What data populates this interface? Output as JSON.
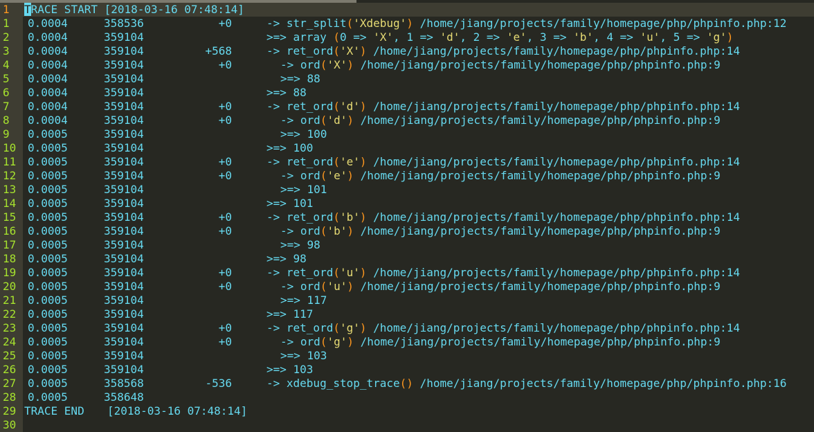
{
  "trace_header": {
    "label": "TRACE START",
    "timestamp": "[2018-03-16 07:48:14]"
  },
  "trace_footer": {
    "label": "TRACE END",
    "timestamp": "[2018-03-16 07:48:14]"
  },
  "rows": [
    {
      "n": "1",
      "time": "0.0004",
      "mem": "358536",
      "delta": "+0",
      "indent": 0,
      "kind": "call",
      "name": "str_split",
      "arg": "'Xdebug'",
      "loc": "/home/jiang/projects/family/homepage/php/phpinfo.php:12"
    },
    {
      "n": "2",
      "time": "0.0004",
      "mem": "359104",
      "delta": "",
      "indent": 0,
      "kind": "array",
      "text": ">=> array (0 => 'X', 1 => 'd', 2 => 'e', 3 => 'b', 4 => 'u', 5 => 'g')"
    },
    {
      "n": "3",
      "time": "0.0004",
      "mem": "359104",
      "delta": "+568",
      "indent": 0,
      "kind": "call",
      "name": "ret_ord",
      "arg": "'X'",
      "loc": "/home/jiang/projects/family/homepage/php/phpinfo.php:14"
    },
    {
      "n": "4",
      "time": "0.0004",
      "mem": "359104",
      "delta": "+0",
      "indent": 1,
      "kind": "call",
      "name": "ord",
      "arg": "'X'",
      "loc": "/home/jiang/projects/family/homepage/php/phpinfo.php:9"
    },
    {
      "n": "5",
      "time": "0.0004",
      "mem": "359104",
      "delta": "",
      "indent": 1,
      "kind": "ret",
      "value": "88"
    },
    {
      "n": "6",
      "time": "0.0004",
      "mem": "359104",
      "delta": "",
      "indent": 0,
      "kind": "ret",
      "value": "88"
    },
    {
      "n": "7",
      "time": "0.0004",
      "mem": "359104",
      "delta": "+0",
      "indent": 0,
      "kind": "call",
      "name": "ret_ord",
      "arg": "'d'",
      "loc": "/home/jiang/projects/family/homepage/php/phpinfo.php:14"
    },
    {
      "n": "8",
      "time": "0.0004",
      "mem": "359104",
      "delta": "+0",
      "indent": 1,
      "kind": "call",
      "name": "ord",
      "arg": "'d'",
      "loc": "/home/jiang/projects/family/homepage/php/phpinfo.php:9"
    },
    {
      "n": "9",
      "time": "0.0005",
      "mem": "359104",
      "delta": "",
      "indent": 1,
      "kind": "ret",
      "value": "100"
    },
    {
      "n": "10",
      "time": "0.0005",
      "mem": "359104",
      "delta": "",
      "indent": 0,
      "kind": "ret",
      "value": "100"
    },
    {
      "n": "11",
      "time": "0.0005",
      "mem": "359104",
      "delta": "+0",
      "indent": 0,
      "kind": "call",
      "name": "ret_ord",
      "arg": "'e'",
      "loc": "/home/jiang/projects/family/homepage/php/phpinfo.php:14"
    },
    {
      "n": "12",
      "time": "0.0005",
      "mem": "359104",
      "delta": "+0",
      "indent": 1,
      "kind": "call",
      "name": "ord",
      "arg": "'e'",
      "loc": "/home/jiang/projects/family/homepage/php/phpinfo.php:9"
    },
    {
      "n": "13",
      "time": "0.0005",
      "mem": "359104",
      "delta": "",
      "indent": 1,
      "kind": "ret",
      "value": "101"
    },
    {
      "n": "14",
      "time": "0.0005",
      "mem": "359104",
      "delta": "",
      "indent": 0,
      "kind": "ret",
      "value": "101"
    },
    {
      "n": "15",
      "time": "0.0005",
      "mem": "359104",
      "delta": "+0",
      "indent": 0,
      "kind": "call",
      "name": "ret_ord",
      "arg": "'b'",
      "loc": "/home/jiang/projects/family/homepage/php/phpinfo.php:14"
    },
    {
      "n": "16",
      "time": "0.0005",
      "mem": "359104",
      "delta": "+0",
      "indent": 1,
      "kind": "call",
      "name": "ord",
      "arg": "'b'",
      "loc": "/home/jiang/projects/family/homepage/php/phpinfo.php:9"
    },
    {
      "n": "17",
      "time": "0.0005",
      "mem": "359104",
      "delta": "",
      "indent": 1,
      "kind": "ret",
      "value": "98"
    },
    {
      "n": "18",
      "time": "0.0005",
      "mem": "359104",
      "delta": "",
      "indent": 0,
      "kind": "ret",
      "value": "98"
    },
    {
      "n": "19",
      "time": "0.0005",
      "mem": "359104",
      "delta": "+0",
      "indent": 0,
      "kind": "call",
      "name": "ret_ord",
      "arg": "'u'",
      "loc": "/home/jiang/projects/family/homepage/php/phpinfo.php:14"
    },
    {
      "n": "20",
      "time": "0.0005",
      "mem": "359104",
      "delta": "+0",
      "indent": 1,
      "kind": "call",
      "name": "ord",
      "arg": "'u'",
      "loc": "/home/jiang/projects/family/homepage/php/phpinfo.php:9"
    },
    {
      "n": "21",
      "time": "0.0005",
      "mem": "359104",
      "delta": "",
      "indent": 1,
      "kind": "ret",
      "value": "117"
    },
    {
      "n": "22",
      "time": "0.0005",
      "mem": "359104",
      "delta": "",
      "indent": 0,
      "kind": "ret",
      "value": "117"
    },
    {
      "n": "23",
      "time": "0.0005",
      "mem": "359104",
      "delta": "+0",
      "indent": 0,
      "kind": "call",
      "name": "ret_ord",
      "arg": "'g'",
      "loc": "/home/jiang/projects/family/homepage/php/phpinfo.php:14"
    },
    {
      "n": "24",
      "time": "0.0005",
      "mem": "359104",
      "delta": "+0",
      "indent": 1,
      "kind": "call",
      "name": "ord",
      "arg": "'g'",
      "loc": "/home/jiang/projects/family/homepage/php/phpinfo.php:9"
    },
    {
      "n": "25",
      "time": "0.0005",
      "mem": "359104",
      "delta": "",
      "indent": 1,
      "kind": "ret",
      "value": "103"
    },
    {
      "n": "26",
      "time": "0.0005",
      "mem": "359104",
      "delta": "",
      "indent": 0,
      "kind": "ret",
      "value": "103"
    },
    {
      "n": "27",
      "time": "0.0005",
      "mem": "358568",
      "delta": "-536",
      "indent": 0,
      "kind": "call",
      "name": "xdebug_stop_trace",
      "arg": "",
      "loc": "/home/jiang/projects/family/homepage/php/phpinfo.php:16"
    },
    {
      "n": "28",
      "time": "0.0005",
      "mem": "358648",
      "delta": "",
      "indent": 0,
      "kind": "none"
    }
  ],
  "footer_line_number": "29",
  "empty_line_number": "30",
  "colors": {
    "background": "#272822",
    "gutter": "#3e3d32",
    "line_number": "#a6e22e",
    "current_line_number": "#fd971f",
    "text": "#66d9ef",
    "string": "#e6db74",
    "paren": "#fd971f"
  }
}
